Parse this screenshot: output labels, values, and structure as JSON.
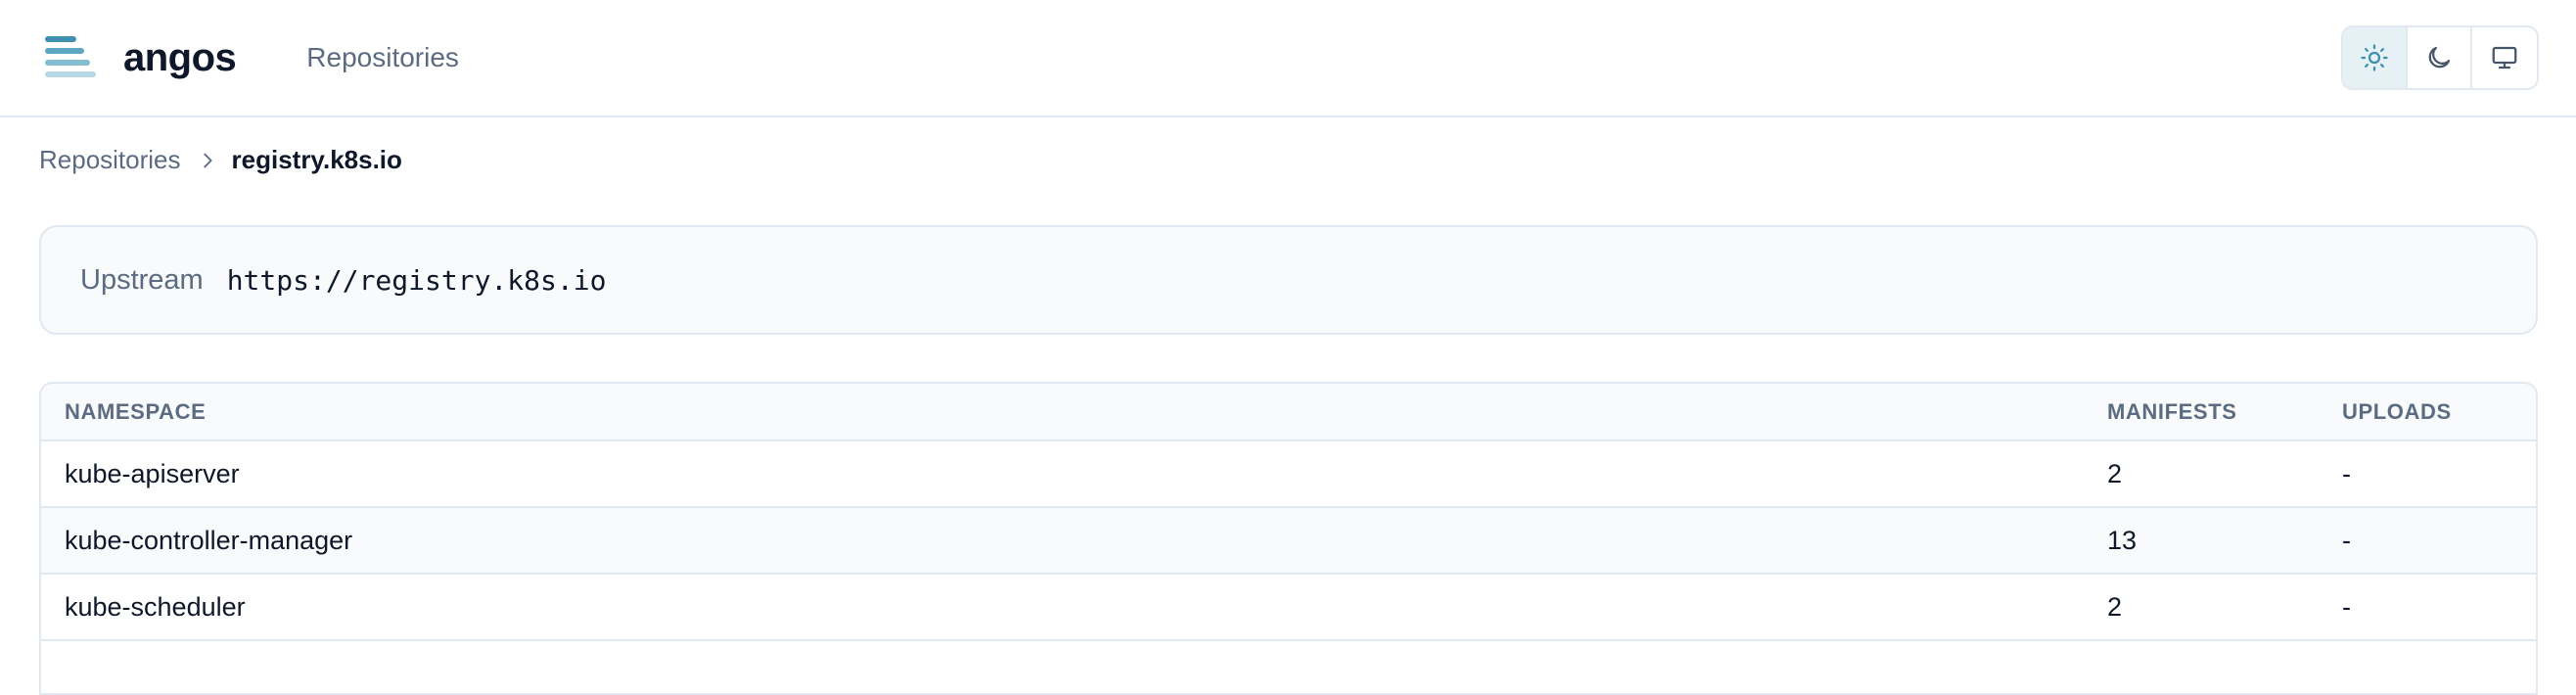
{
  "header": {
    "brand": "angos",
    "nav": {
      "repositories": "Repositories"
    },
    "theme": {
      "options": [
        {
          "name": "light",
          "icon": "sun-icon",
          "active": true
        },
        {
          "name": "dark",
          "icon": "moon-icon",
          "active": false
        },
        {
          "name": "system",
          "icon": "monitor-icon",
          "active": false
        }
      ]
    }
  },
  "breadcrumb": {
    "parent": "Repositories",
    "current": "registry.k8s.io"
  },
  "upstream": {
    "label": "Upstream",
    "url": "https://registry.k8s.io"
  },
  "table": {
    "headers": {
      "namespace": "NAMESPACE",
      "manifests": "MANIFESTS",
      "uploads": "UPLOADS"
    },
    "rows": [
      {
        "namespace": "kube-apiserver",
        "manifests": "2",
        "uploads": "-"
      },
      {
        "namespace": "kube-controller-manager",
        "manifests": "13",
        "uploads": "-"
      },
      {
        "namespace": "kube-scheduler",
        "manifests": "2",
        "uploads": "-"
      }
    ]
  },
  "colors": {
    "accent": "#3f8fae",
    "muted_text": "#5b6b82",
    "border": "#e2e8f0",
    "subtle_bg": "#f8fafc"
  }
}
